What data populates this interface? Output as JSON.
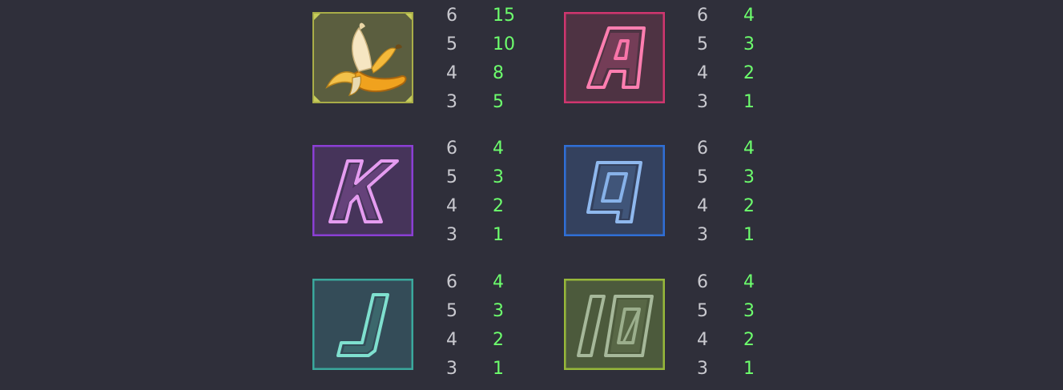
{
  "theme": {
    "background": "#2f2f3a",
    "count_color": "#c9c9cf",
    "payout_color": "#6dff6d"
  },
  "symbols": [
    {
      "id": "banana",
      "icon": "banana-icon",
      "frame_color": "#b3b84a",
      "pays": [
        {
          "count": "6",
          "payout": "15"
        },
        {
          "count": "5",
          "payout": "10"
        },
        {
          "count": "4",
          "payout": "8"
        },
        {
          "count": "3",
          "payout": "5"
        }
      ]
    },
    {
      "id": "ace",
      "icon": "letter-a-icon",
      "frame_color": "#e0407a",
      "pays": [
        {
          "count": "6",
          "payout": "4"
        },
        {
          "count": "5",
          "payout": "3"
        },
        {
          "count": "4",
          "payout": "2"
        },
        {
          "count": "3",
          "payout": "1"
        }
      ]
    },
    {
      "id": "king",
      "icon": "letter-k-icon",
      "frame_color": "#9a3fe0",
      "pays": [
        {
          "count": "6",
          "payout": "4"
        },
        {
          "count": "5",
          "payout": "3"
        },
        {
          "count": "4",
          "payout": "2"
        },
        {
          "count": "3",
          "payout": "1"
        }
      ]
    },
    {
      "id": "queen",
      "icon": "letter-q-icon",
      "frame_color": "#3b7fe0",
      "pays": [
        {
          "count": "6",
          "payout": "4"
        },
        {
          "count": "5",
          "payout": "3"
        },
        {
          "count": "4",
          "payout": "2"
        },
        {
          "count": "3",
          "payout": "1"
        }
      ]
    },
    {
      "id": "jack",
      "icon": "letter-j-icon",
      "frame_color": "#3fb6a8",
      "pays": [
        {
          "count": "6",
          "payout": "4"
        },
        {
          "count": "5",
          "payout": "3"
        },
        {
          "count": "4",
          "payout": "2"
        },
        {
          "count": "3",
          "payout": "1"
        }
      ]
    },
    {
      "id": "ten",
      "icon": "number-10-icon",
      "frame_color": "#9fbd3a",
      "pays": [
        {
          "count": "6",
          "payout": "4"
        },
        {
          "count": "5",
          "payout": "3"
        },
        {
          "count": "4",
          "payout": "2"
        },
        {
          "count": "3",
          "payout": "1"
        }
      ]
    }
  ]
}
